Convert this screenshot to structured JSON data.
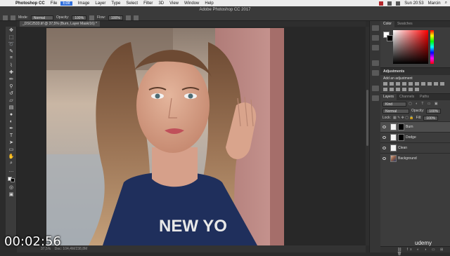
{
  "menubar": {
    "app_name": "Photoshop CC",
    "items": [
      "File",
      "Edit",
      "Image",
      "Layer",
      "Type",
      "Select",
      "Filter",
      "3D",
      "View",
      "Window",
      "Help"
    ],
    "active_index": 1,
    "clock": "Sun 20:53",
    "user": "Marcin"
  },
  "window_title": "Adobe Photoshop CC 2017",
  "options_bar": {
    "mode_label": "Mode:",
    "mode_value": "Normal",
    "opacity_label": "Opacity:",
    "opacity_value": "100%",
    "flow_label": "Flow:",
    "flow_value": "100%"
  },
  "document_tab": "_DSC2533.tif @ 37,5% (Burn, Layer Mask/16) *",
  "status_bar": {
    "zoom": "37,5%",
    "doc_info": "Doc: 104,4M/238,8M"
  },
  "panels": {
    "color_tabs": [
      "Color",
      "Swatches"
    ],
    "adjustments_title": "Adjustments",
    "adjustments_hint": "Add an adjustment",
    "layers_tabs": [
      "Layers",
      "Channels",
      "Paths"
    ],
    "kind_label": "Kind",
    "blend_mode": "Normal",
    "opacity_label": "Opacity:",
    "opacity_value": "100%",
    "lock_label": "Lock:",
    "fill_label": "Fill:",
    "fill_value": "100%",
    "layers": [
      {
        "name": "Burn",
        "selected": true
      },
      {
        "name": "Dodge",
        "selected": false
      },
      {
        "name": "Clean",
        "selected": false
      },
      {
        "name": "Background",
        "selected": false
      }
    ]
  },
  "video": {
    "timestamp": "00:02:56",
    "watermark": "udemy"
  },
  "colors": {
    "accent": "#2f6fde",
    "panel": "#3c3c3c"
  }
}
